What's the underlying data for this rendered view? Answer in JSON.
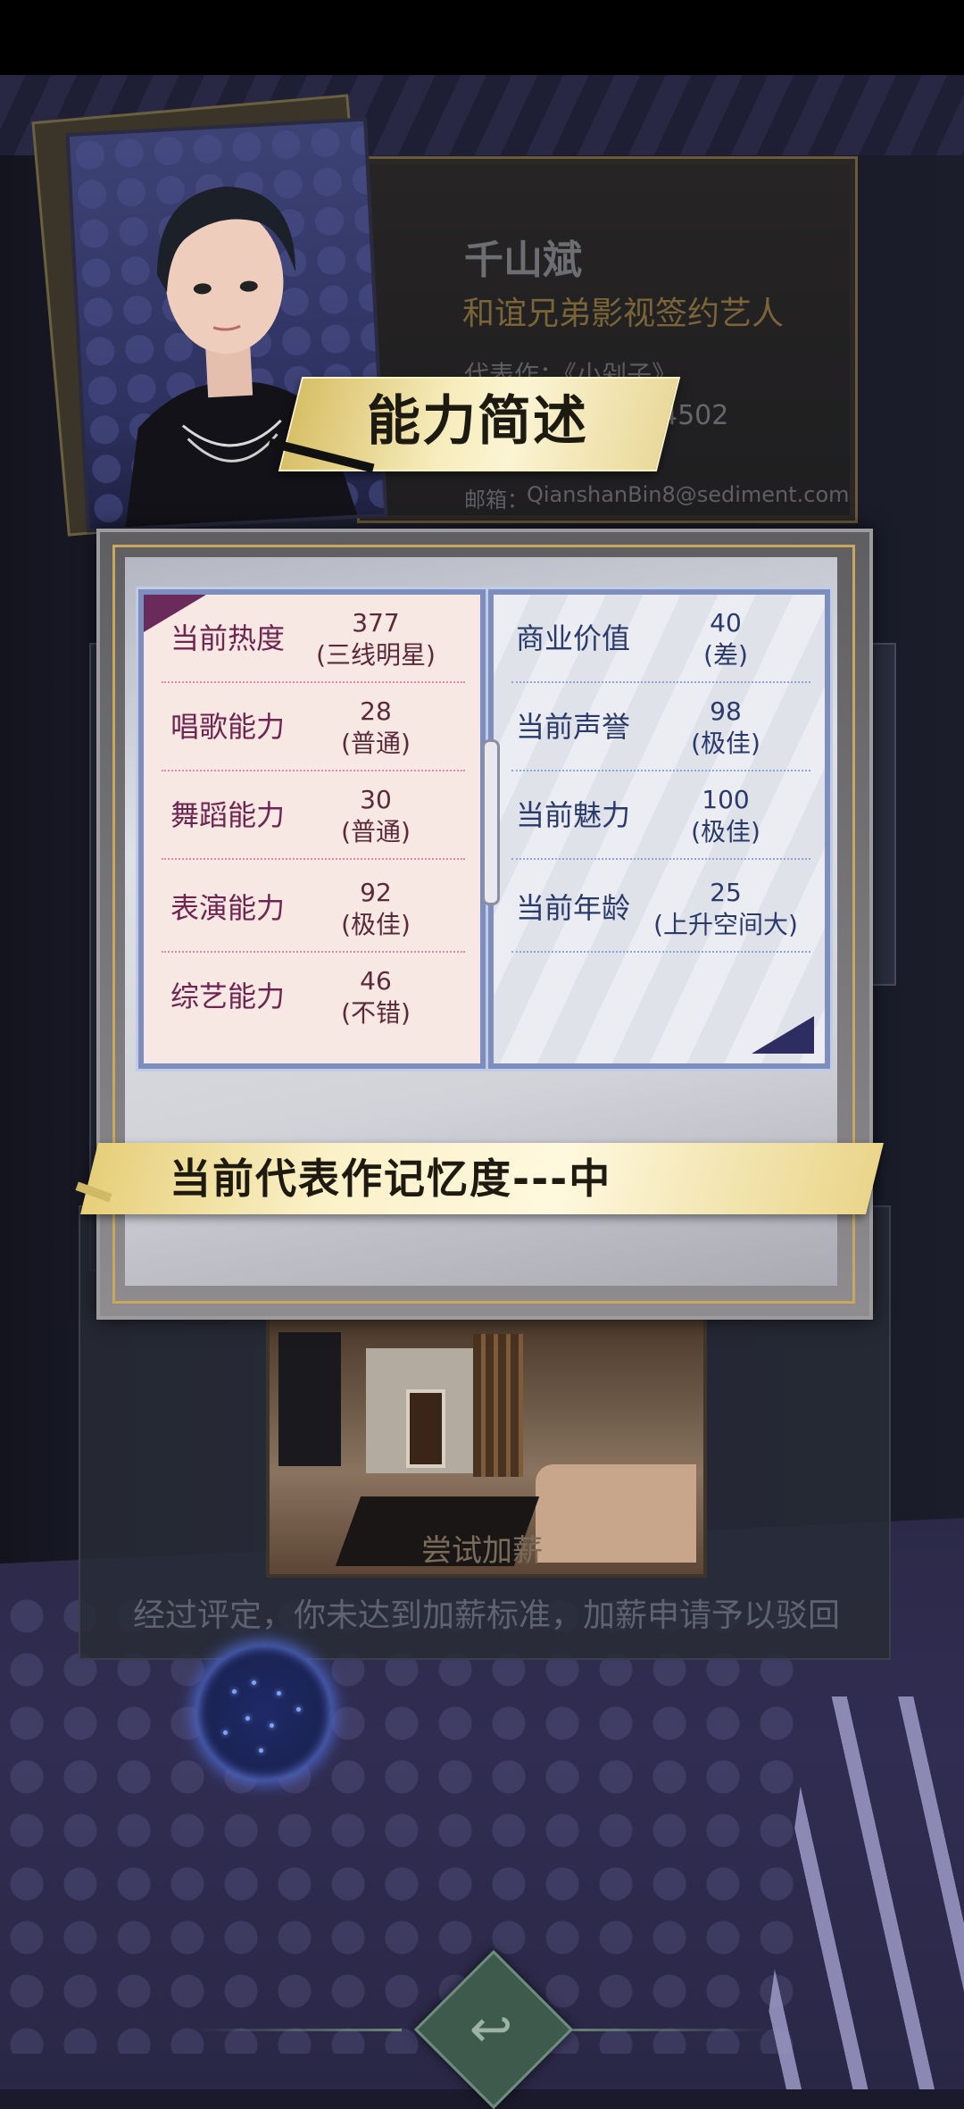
{
  "profile": {
    "name": "千山斌",
    "title": "和谊兄弟影视签约艺人",
    "works": "代表作：《小剁子》",
    "id_fragment": "4502",
    "email_label": "邮箱：",
    "email": "QianshanBin8@sediment.com"
  },
  "section_title": "能力简述",
  "stats_left": [
    {
      "label": "当前热度",
      "value": "377",
      "grade": "(三线明星)"
    },
    {
      "label": "唱歌能力",
      "value": "28",
      "grade": "(普通)"
    },
    {
      "label": "舞蹈能力",
      "value": "30",
      "grade": "(普通)"
    },
    {
      "label": "表演能力",
      "value": "92",
      "grade": "(极佳)"
    },
    {
      "label": "综艺能力",
      "value": "46",
      "grade": "(不错)"
    }
  ],
  "stats_right": [
    {
      "label": "商业价值",
      "value": "40",
      "grade": "(差)"
    },
    {
      "label": "当前声誉",
      "value": "98",
      "grade": "(极佳)"
    },
    {
      "label": "当前魅力",
      "value": "100",
      "grade": "(极佳)"
    },
    {
      "label": "当前年龄",
      "value": "25",
      "grade": "(上升空间大)"
    }
  ],
  "memory_banner": "当前代表作记忆度---中",
  "raise_button": "尝试加薪",
  "raise_message": "经过评定，你未达到加薪标准，加薪申请予以驳回",
  "back_icon": "back-arrow-icon",
  "colors": {
    "gold": "#c9a75c",
    "pink_label": "#702450",
    "blue_label": "#2a3a6a",
    "banner": "#fbf1c8"
  }
}
